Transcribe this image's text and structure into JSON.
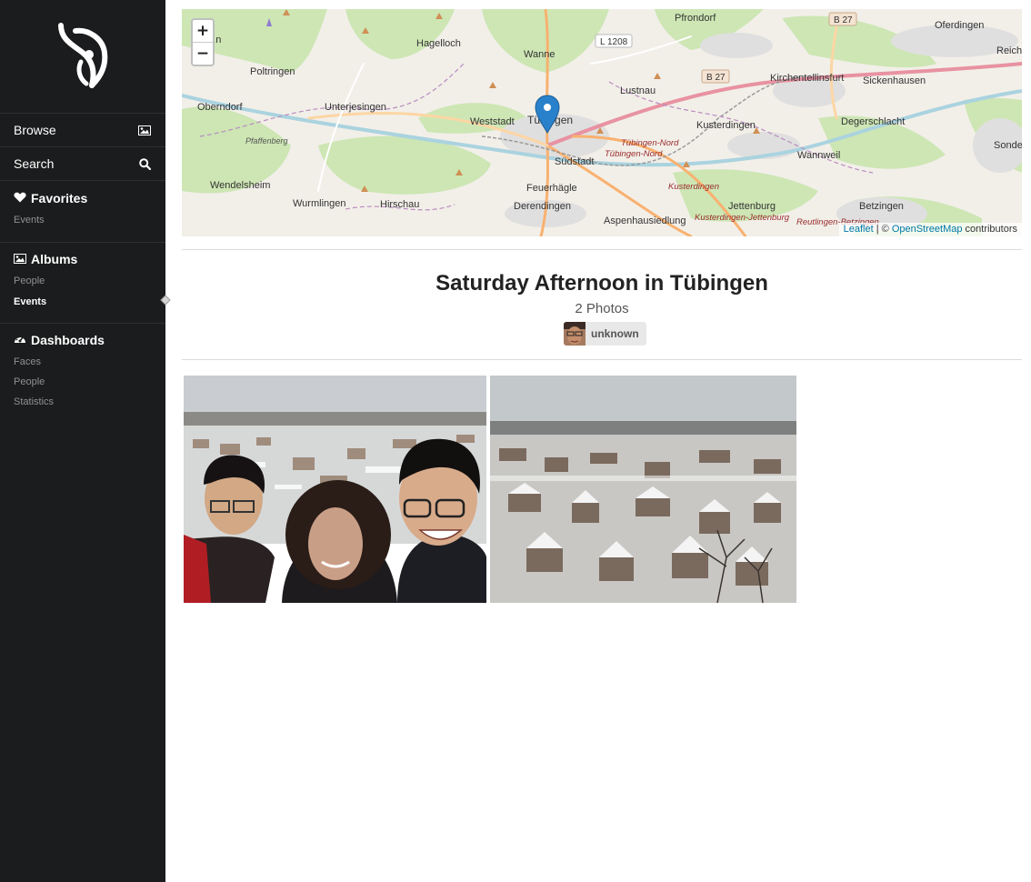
{
  "sidebar": {
    "logo_icon": "app-logo",
    "browse": {
      "label": "Browse",
      "icon": "image-icon"
    },
    "search": {
      "label": "Search",
      "icon": "search-icon"
    },
    "favorites": {
      "label": "Favorites",
      "icon": "heart-icon",
      "items": [
        "Events"
      ]
    },
    "albums": {
      "label": "Albums",
      "icon": "image-icon",
      "items": [
        "People",
        "Events"
      ],
      "active": "Events"
    },
    "dashboards": {
      "label": "Dashboards",
      "icon": "dashboard-icon",
      "items": [
        "Faces",
        "People",
        "Statistics"
      ]
    }
  },
  "map": {
    "zoom_in": "+",
    "zoom_out": "−",
    "attribution": {
      "leaflet": "Leaflet",
      "separator": " | © ",
      "osm": "OpenStreetMap",
      "suffix": " contributors"
    },
    "labels": {
      "reutlingen": "Re...n",
      "pfrondorf": "Pfrondorf",
      "b27a": "B 27",
      "ofterdingen": "Oferdingen",
      "reich": "Reich",
      "hagelloch": "Hagelloch",
      "l1208": "L 1208",
      "wanne": "Wanne",
      "poltringen": "Poltringen",
      "lustnau": "Lustnau",
      "b27b": "B 27",
      "kirchentellinsfurt": "Kirchentellinsfurt",
      "sickenhausen": "Sickenhausen",
      "oberndorf": "Oberndorf",
      "unterjesingen": "Unterjesingen",
      "weststadt": "Weststadt",
      "tuebingen": "Tübingen",
      "kusterdingen": "Kusterdingen",
      "degerschlacht": "Degerschlacht",
      "pfaffenberg": "Pfaffenberg",
      "tuebingen_nord1": "Tübingen-Nord",
      "tuebingen_nord2": "Tübingen-Nord",
      "sonde": "Sonde",
      "suedstadt": "Südstadt",
      "wannweil": "Wannweil",
      "wendelsheim": "Wendelsheim",
      "feuerhaegle": "Feuerhägle",
      "kusterdingen2": "Kusterdingen",
      "wurmlingen": "Wurmlingen",
      "hirschau": "Hirschau",
      "derendingen": "Derendingen",
      "jettenburg": "Jettenburg",
      "betzingen": "Betzingen",
      "aspenhausiedlung": "Aspenhausiedlung",
      "kusterdingen_jettenburg": "Kusterdingen-Jettenburg",
      "reutlingen_betzingen": "Reutlingen-Betzingen"
    }
  },
  "album": {
    "title": "Saturday Afternoon in Tübingen",
    "count": "2 Photos",
    "person": "unknown"
  }
}
